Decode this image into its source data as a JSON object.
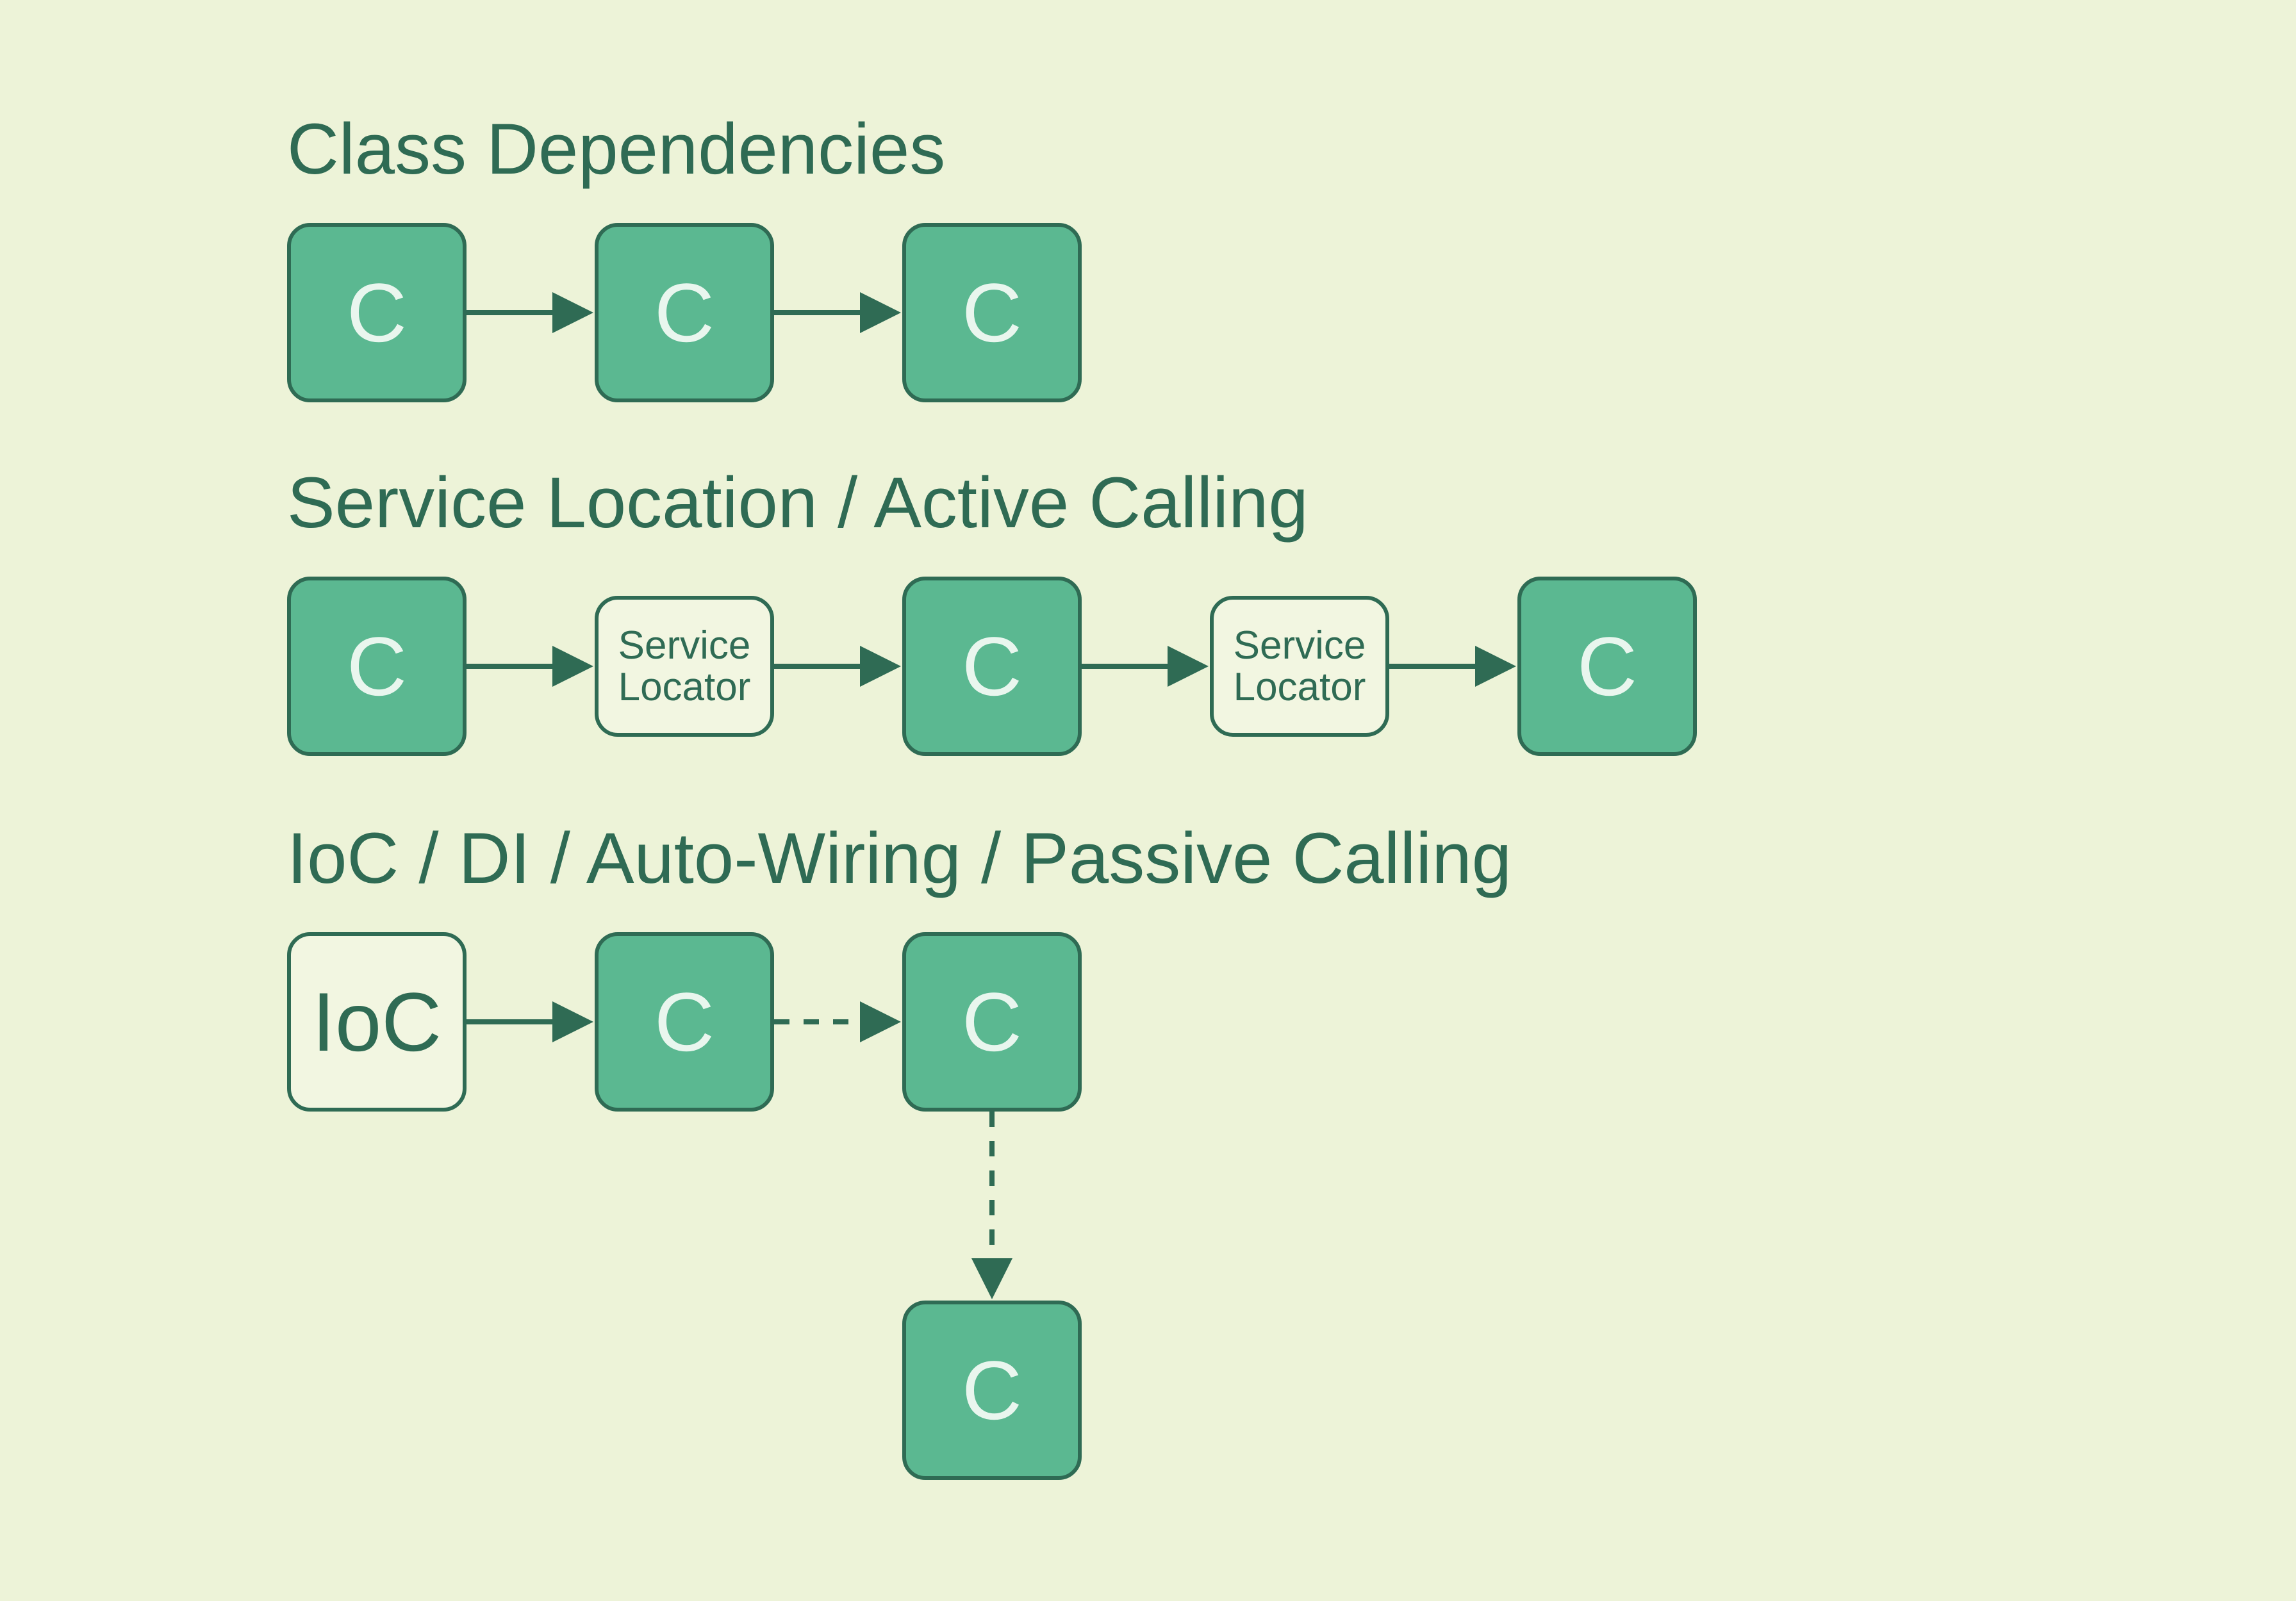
{
  "colors": {
    "background": "#edf3d8",
    "title": "#2f6b54",
    "nodeFill": "#5bb891",
    "nodeStroke": "#2f6b54",
    "lightFill": "#f2f6e1",
    "arrow": "#2f6b54"
  },
  "sections": {
    "deps": {
      "title": "Class Dependencies",
      "nodes": {
        "c1": "C",
        "c2": "C",
        "c3": "C"
      }
    },
    "svc": {
      "title": "Service Location / Active Calling",
      "nodes": {
        "c1": "C",
        "sl1": "Service\nLocator",
        "c2": "C",
        "sl2": "Service\nLocator",
        "c3": "C"
      }
    },
    "ioc": {
      "title": "IoC / DI / Auto-Wiring / Passive Calling",
      "nodes": {
        "ioc": "IoC",
        "c1": "C",
        "c2": "C",
        "c3": "C"
      }
    }
  }
}
